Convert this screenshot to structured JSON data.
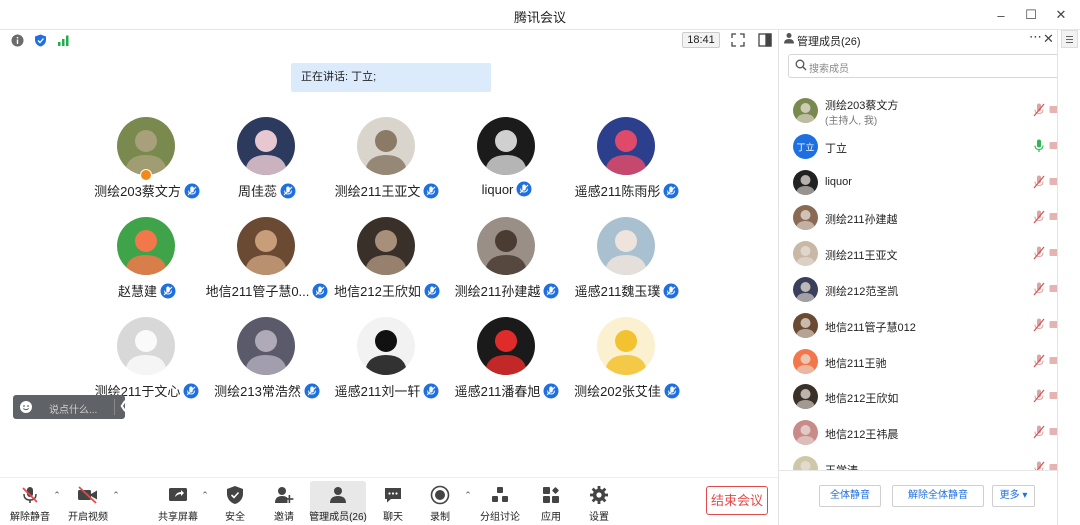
{
  "window": {
    "title": "腾讯会议",
    "clock": "18:41"
  },
  "speaking": {
    "text": "正在讲话: 丁立;"
  },
  "participants": [
    {
      "name": "测绘203蔡文方",
      "host": true
    },
    {
      "name": "周佳蕊"
    },
    {
      "name": "测绘211王亚文"
    },
    {
      "name": "liquor"
    },
    {
      "name": "遥感211陈雨彤"
    },
    {
      "name": "赵慧建"
    },
    {
      "name": "地信211管子慧0..."
    },
    {
      "name": "地信212王欣如"
    },
    {
      "name": "测绘211孙建越"
    },
    {
      "name": "遥感211魏玉璞"
    },
    {
      "name": "测绘211于文心"
    },
    {
      "name": "测绘213常浩然"
    },
    {
      "name": "遥感211刘一轩"
    },
    {
      "name": "遥感211潘春旭"
    },
    {
      "name": "测绘202张艾佳"
    }
  ],
  "chat": {
    "placeholder": "说点什么..."
  },
  "toolbar": {
    "unmute": "解除静音",
    "video": "开启视频",
    "share": "共享屏幕",
    "security": "安全",
    "invite": "邀请",
    "members": "管理成员(26)",
    "chat": "聊天",
    "record": "录制",
    "breakout": "分组讨论",
    "apps": "应用",
    "settings": "设置",
    "end": "结束会议"
  },
  "sidebar": {
    "title": "管理成员(26)",
    "search_placeholder": "搜索成员",
    "members": [
      {
        "name": "测绘203蔡文方",
        "sub": "(主持人, 我)"
      },
      {
        "name": "丁立",
        "initials": "丁立",
        "speaking": true
      },
      {
        "name": "liquor"
      },
      {
        "name": "测绘211孙建越"
      },
      {
        "name": "测绘211王亚文"
      },
      {
        "name": "测绘212范圣凯"
      },
      {
        "name": "地信211管子慧012"
      },
      {
        "name": "地信211王驰"
      },
      {
        "name": "地信212王欣如"
      },
      {
        "name": "地信212王祎晨"
      },
      {
        "name": "王学涛"
      }
    ],
    "mute_all": "全体静音",
    "unmute_all": "解除全体静音",
    "more": "更多 ▾"
  }
}
